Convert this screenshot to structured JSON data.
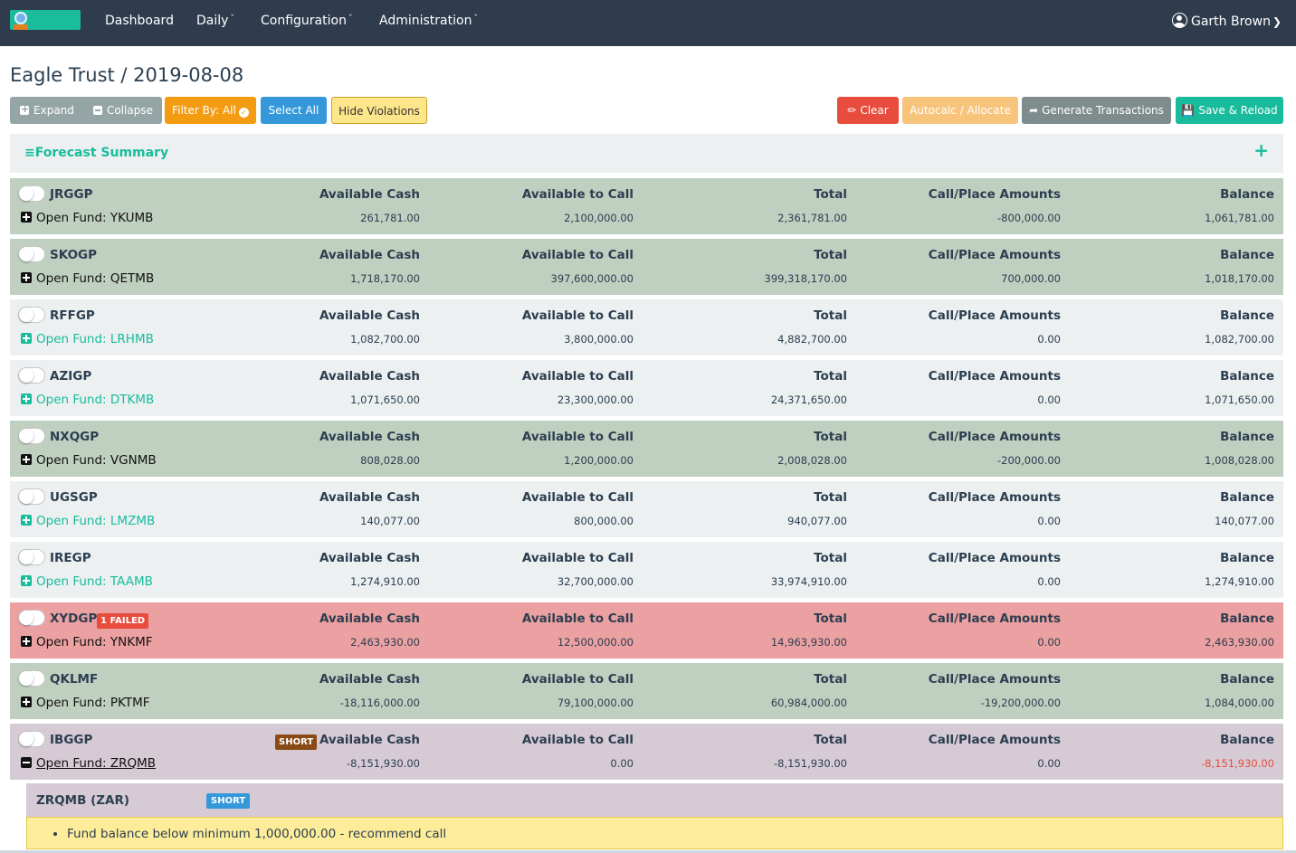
{
  "nav": {
    "items": [
      "Dashboard",
      "Daily",
      "Configuration",
      "Administration"
    ],
    "user": "Garth Brown"
  },
  "page": {
    "title": "Eagle Trust / 2019-08-08"
  },
  "toolbar": {
    "expand": "Expand",
    "collapse": "Collapse",
    "filter": "Filter By: All",
    "select_all": "Select All",
    "hide_violations": "Hide Violations",
    "clear": "Clear",
    "autocalc": "Autocalc / Allocate",
    "generate": "Generate Transactions",
    "save": "Save & Reload"
  },
  "summary": {
    "title": "Forecast Summary",
    "plus": "+"
  },
  "columns": [
    "Available Cash",
    "Available to Call",
    "Total",
    "Call/Place Amounts",
    "Balance"
  ],
  "funds": [
    {
      "code": "JRGGP",
      "open_fund": "Open Fund: YKUMB",
      "values": [
        "261,781.00",
        "2,100,000.00",
        "2,361,781.00",
        "-800,000.00",
        "1,061,781.00"
      ],
      "status": "green"
    },
    {
      "code": "SKOGP",
      "open_fund": "Open Fund: QETMB",
      "values": [
        "1,718,170.00",
        "397,600,000.00",
        "399,318,170.00",
        "700,000.00",
        "1,018,170.00"
      ],
      "status": "green"
    },
    {
      "code": "RFFGP",
      "open_fund": "Open Fund: LRHMB",
      "values": [
        "1,082,700.00",
        "3,800,000.00",
        "4,882,700.00",
        "0.00",
        "1,082,700.00"
      ],
      "status": "light"
    },
    {
      "code": "AZIGP",
      "open_fund": "Open Fund: DTKMB",
      "values": [
        "1,071,650.00",
        "23,300,000.00",
        "24,371,650.00",
        "0.00",
        "1,071,650.00"
      ],
      "status": "light"
    },
    {
      "code": "NXQGP",
      "open_fund": "Open Fund: VGNMB",
      "values": [
        "808,028.00",
        "1,200,000.00",
        "2,008,028.00",
        "-200,000.00",
        "1,008,028.00"
      ],
      "status": "green"
    },
    {
      "code": "UGSGP",
      "open_fund": "Open Fund: LMZMB",
      "values": [
        "140,077.00",
        "800,000.00",
        "940,077.00",
        "0.00",
        "140,077.00"
      ],
      "status": "light"
    },
    {
      "code": "IREGP",
      "open_fund": "Open Fund: TAAMB",
      "values": [
        "1,274,910.00",
        "32,700,000.00",
        "33,974,910.00",
        "0.00",
        "1,274,910.00"
      ],
      "status": "light"
    },
    {
      "code": "XYDGP",
      "badge": "1 FAILED",
      "open_fund": "Open Fund: YNKMF",
      "values": [
        "2,463,930.00",
        "12,500,000.00",
        "14,963,930.00",
        "0.00",
        "2,463,930.00"
      ],
      "status": "red"
    },
    {
      "code": "QKLMF",
      "open_fund": "Open Fund: PKTMF",
      "values": [
        "-18,116,000.00",
        "79,100,000.00",
        "60,984,000.00",
        "-19,200,000.00",
        "1,084,000.00"
      ],
      "status": "green"
    },
    {
      "code": "IBGGP",
      "badge": "SHORT",
      "open_fund": "Open Fund: ZRQMB",
      "values": [
        "-8,151,930.00",
        "0.00",
        "-8,151,930.00",
        "0.00",
        "-8,151,930.00"
      ],
      "status": "mauve"
    }
  ],
  "detail": {
    "code": "ZRQMB (ZAR)",
    "badge": "SHORT",
    "warning": "Fund balance below minimum 1,000,000.00 - recommend call"
  },
  "colors": {
    "navbar": "#2e3c4d",
    "teal": "#18bc9c",
    "row_green": "#bfcfc0",
    "row_light": "#ecf0f1",
    "row_red": "#eba0a1",
    "row_mauve": "#d6cbd4",
    "warning_bg": "#fdec9a"
  },
  "icons": [
    "logo-globe",
    "user-circle-icon",
    "chevron-down-icon",
    "plus-square-icon",
    "minus-square-icon",
    "eraser-icon",
    "share-icon",
    "save-icon",
    "bars-icon",
    "check-circle-icon"
  ]
}
